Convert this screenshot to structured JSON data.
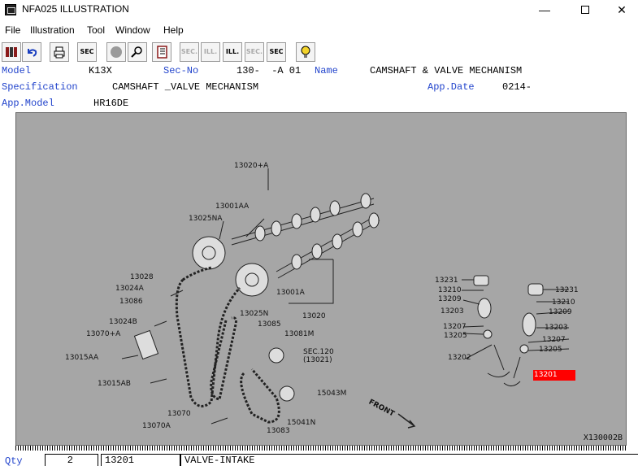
{
  "window": {
    "title": "NFA025  ILLUSTRATION",
    "minimize": "—",
    "close": "✕"
  },
  "menu": [
    "File",
    "Illustration",
    "Tool",
    "Window",
    "Help"
  ],
  "toolbar": {
    "sec_label": "SEC",
    "nav": [
      "SEC.",
      "ILL.",
      "ILL.",
      "SEC.",
      "SEC"
    ]
  },
  "header": {
    "model_label": "Model",
    "model_value": "K13X",
    "secno_label": "Sec-No",
    "secno_value": "130-  -A 01",
    "name_label": "Name",
    "name_value": "CAMSHAFT & VALVE MECHANISM",
    "spec_label": "Specification",
    "spec_value": "CAMSHAFT _VALVE MECHANISM",
    "appdate_label": "App.Date",
    "appdate_value": "0214-",
    "appmodel_label": "App.Model",
    "appmodel_value": "HR16DE"
  },
  "illustration": {
    "labels": [
      "13020+A",
      "13001AA",
      "13025NA",
      "13028",
      "13024A",
      "13086",
      "13024B",
      "13070+A",
      "13015AA",
      "13015AB",
      "13001A",
      "13025N",
      "13020",
      "13085",
      "13081M",
      "SEC.120",
      "(13021)",
      "15043M",
      "13070",
      "13070A",
      "15041N",
      "13083",
      "FRONT",
      "13231",
      "13210",
      "13209",
      "13203",
      "13207",
      "13205",
      "13202",
      "13231",
      "13210",
      "13209",
      "13203",
      "13207",
      "13205"
    ],
    "selected_part": "13201",
    "code": "X130002B"
  },
  "bottom": {
    "qty_label": "Qty",
    "qty_value": "2",
    "part_no": "13201",
    "part_name": "VALVE-INTAKE"
  }
}
